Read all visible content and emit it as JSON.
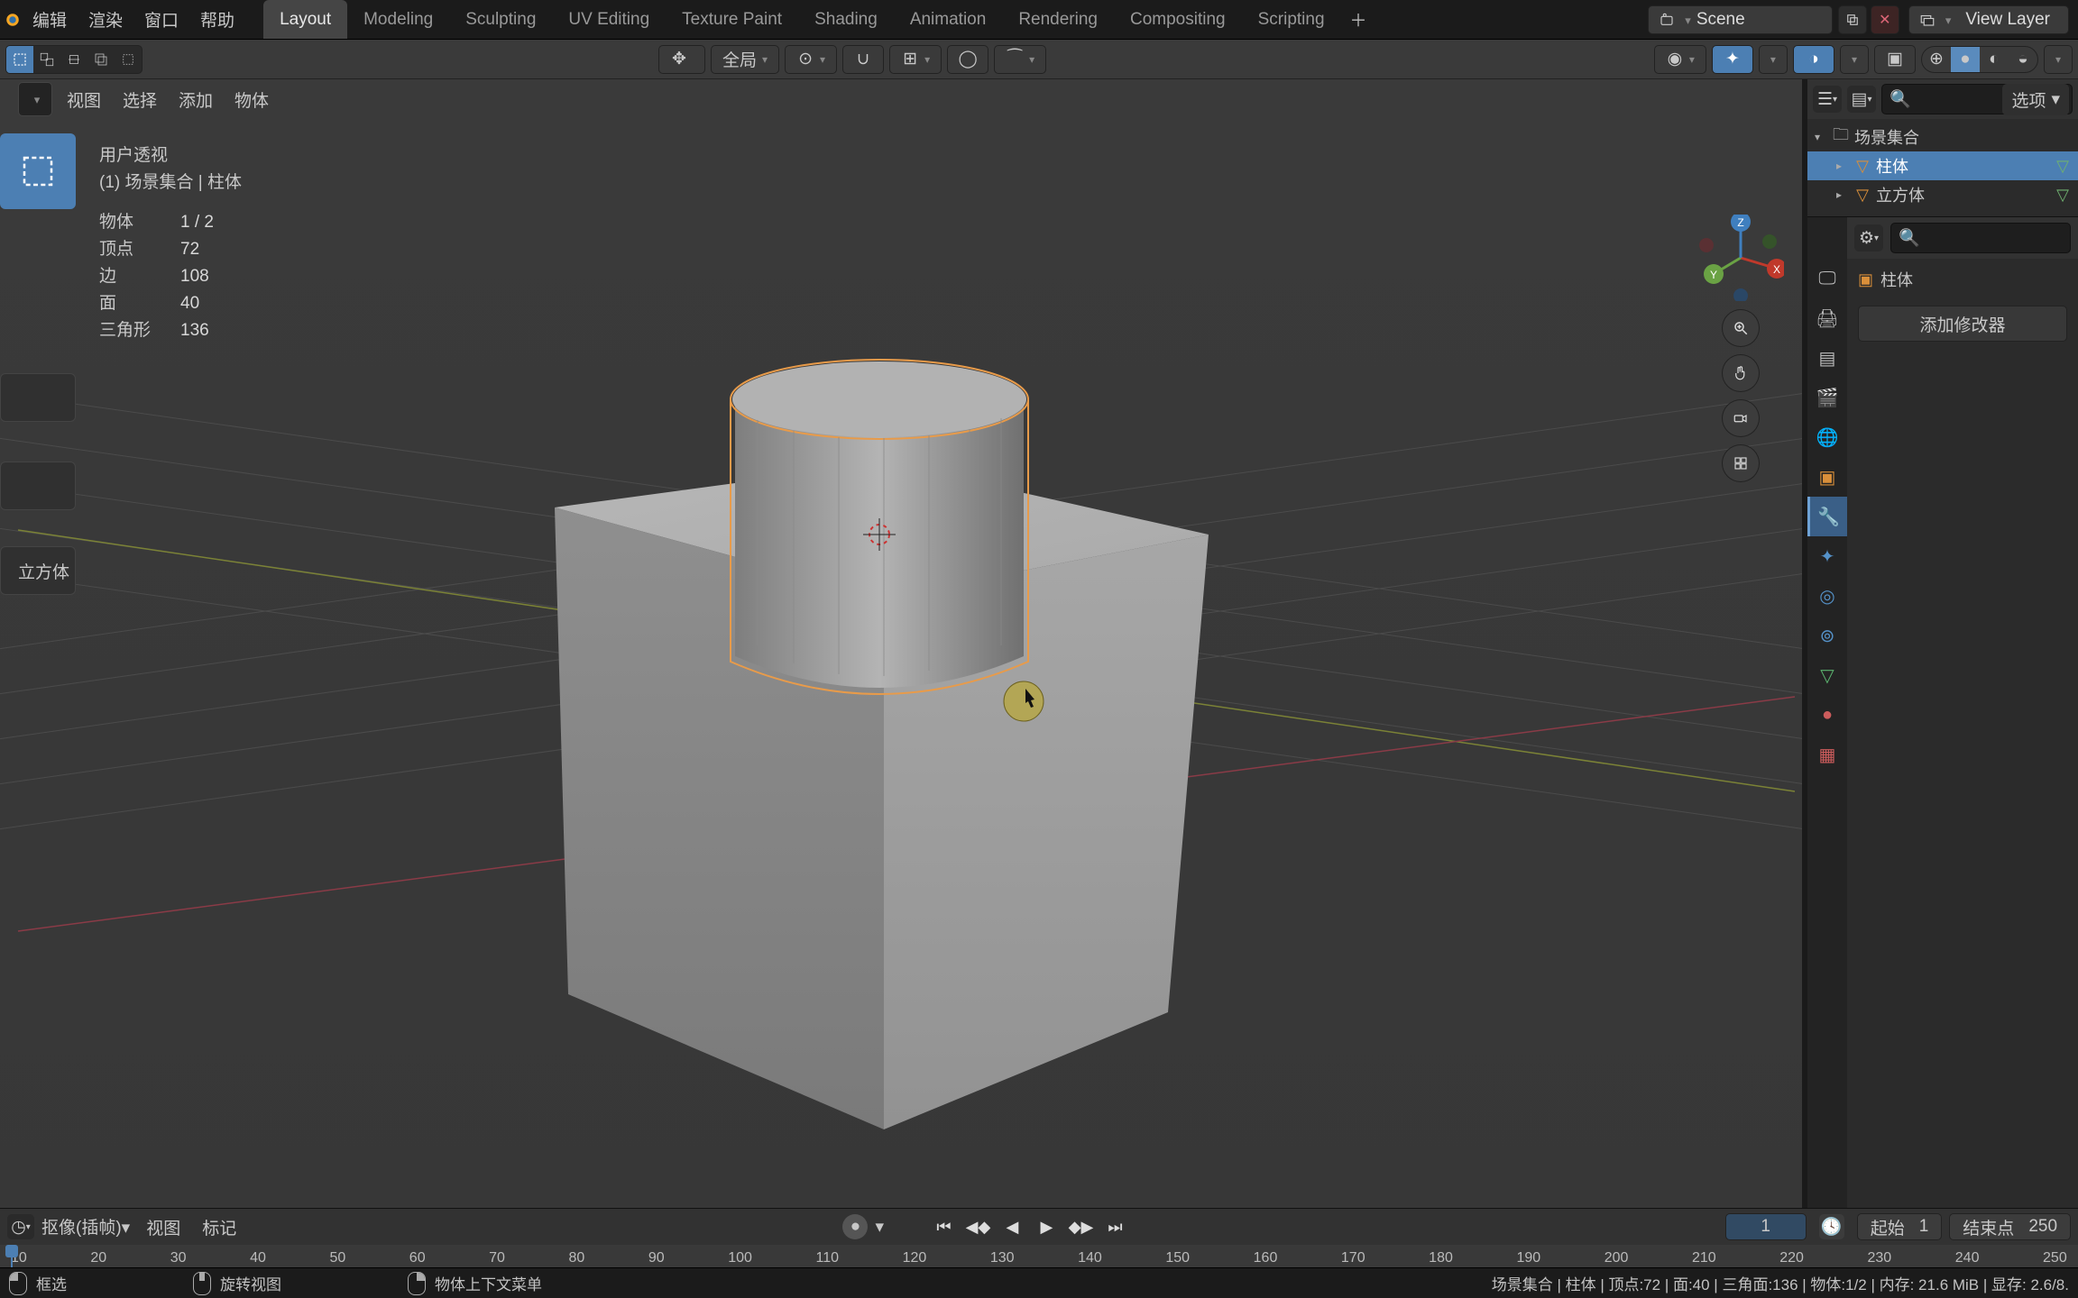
{
  "menubar": {
    "items": [
      "编辑",
      "渲染",
      "窗口",
      "帮助"
    ],
    "workspaces": [
      "Layout",
      "Modeling",
      "Sculpting",
      "UV Editing",
      "Texture Paint",
      "Shading",
      "Animation",
      "Rendering",
      "Compositing",
      "Scripting"
    ],
    "active_workspace": "Layout",
    "scene_label": "Scene",
    "viewlayer_label": "View Layer"
  },
  "header2": {
    "transform_label": "全局",
    "options_label": "选项"
  },
  "header3": {
    "items": [
      "视图",
      "选择",
      "添加",
      "物体"
    ]
  },
  "overlay": {
    "title": "用户透视",
    "subtitle": "(1) 场景集合 | 柱体",
    "stats": [
      {
        "label": "物体",
        "value": "1 / 2"
      },
      {
        "label": "顶点",
        "value": "72"
      },
      {
        "label": "边",
        "value": "108"
      },
      {
        "label": "面",
        "value": "40"
      },
      {
        "label": "三角形",
        "value": "136"
      }
    ]
  },
  "toolshelf_partial": "立方体",
  "outliner": {
    "root": "场景集合",
    "items": [
      {
        "name": "柱体",
        "selected": true
      },
      {
        "name": "立方体",
        "selected": false
      }
    ]
  },
  "properties": {
    "breadcrumb_object": "柱体",
    "add_modifier_label": "添加修改器"
  },
  "timeline": {
    "mode": "抠像(插帧)",
    "menus": [
      "视图",
      "标记"
    ],
    "current": "1",
    "start_label": "起始",
    "start_value": "1",
    "end_label": "结束点",
    "end_value": "250",
    "ticks": [
      "10",
      "20",
      "30",
      "40",
      "50",
      "60",
      "70",
      "80",
      "90",
      "100",
      "110",
      "120",
      "130",
      "140",
      "150",
      "160",
      "170",
      "180",
      "190",
      "200",
      "210",
      "220",
      "230",
      "240",
      "250"
    ]
  },
  "status": {
    "hints": [
      {
        "mouse": "left",
        "text": "框选"
      },
      {
        "mouse": "mid",
        "text": "旋转视图"
      },
      {
        "mouse": "right",
        "text": "物体上下文菜单"
      }
    ],
    "right": "场景集合 | 柱体 | 顶点:72 | 面:40 | 三角面:136 | 物体:1/2 | 内存: 21.6 MiB | 显存: 2.6/8."
  },
  "gizmo_axes": {
    "x": "X",
    "y": "Y",
    "z": "Z"
  }
}
